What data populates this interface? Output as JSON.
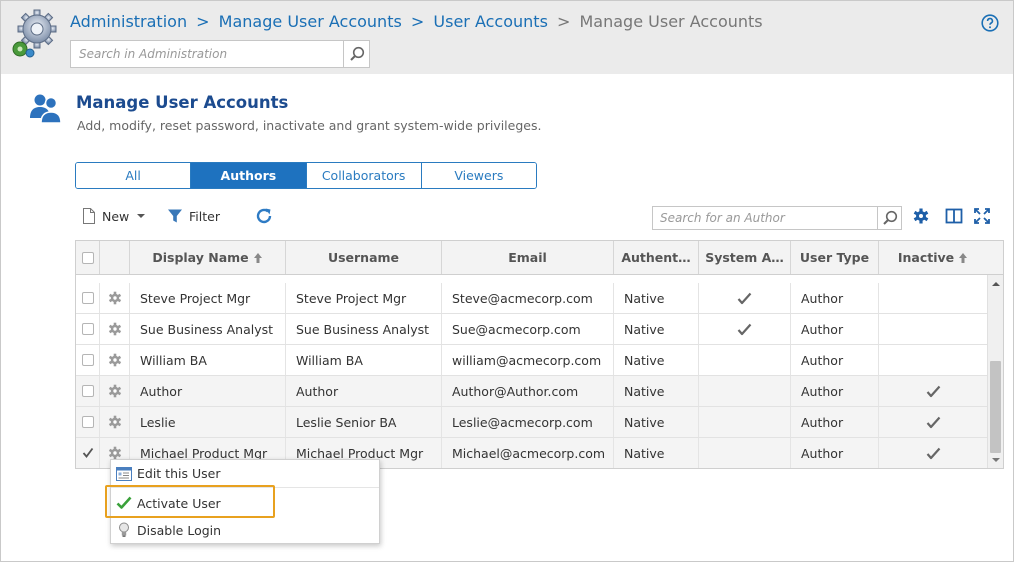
{
  "breadcrumb": {
    "items": [
      "Administration",
      "Manage User Accounts",
      "User Accounts"
    ],
    "current": "Manage User Accounts",
    "separator": ">"
  },
  "admin_search": {
    "placeholder": "Search in Administration"
  },
  "header": {
    "title": "Manage User Accounts",
    "description": "Add, modify, reset password, inactivate and grant system-wide privileges."
  },
  "tabs": [
    {
      "label": "All",
      "active": false
    },
    {
      "label": "Authors",
      "active": true
    },
    {
      "label": "Collaborators",
      "active": false
    },
    {
      "label": "Viewers",
      "active": false
    }
  ],
  "toolbar": {
    "new_label": "New",
    "filter_label": "Filter",
    "author_search_placeholder": "Search for an Author"
  },
  "grid": {
    "columns": [
      "Display Name",
      "Username",
      "Email",
      "Authent…",
      "System A…",
      "User Type",
      "Inactive"
    ],
    "sorted_columns": [
      "Display Name",
      "Inactive"
    ],
    "rows": [
      {
        "display_name": "Steve Project Mgr",
        "username": "Steve Project Mgr",
        "email": "Steve@acmecorp.com",
        "auth": "Native",
        "system_admin": true,
        "user_type": "Author",
        "inactive": false,
        "selected": false,
        "shaded": false
      },
      {
        "display_name": "Sue Business Analyst",
        "username": "Sue Business Analyst",
        "email": "Sue@acmecorp.com",
        "auth": "Native",
        "system_admin": true,
        "user_type": "Author",
        "inactive": false,
        "selected": false,
        "shaded": false
      },
      {
        "display_name": "William BA",
        "username": "William BA",
        "email": "william@acmecorp.com",
        "auth": "Native",
        "system_admin": false,
        "user_type": "Author",
        "inactive": false,
        "selected": false,
        "shaded": false
      },
      {
        "display_name": "Author",
        "username": "Author",
        "email": "Author@Author.com",
        "auth": "Native",
        "system_admin": false,
        "user_type": "Author",
        "inactive": true,
        "selected": false,
        "shaded": true
      },
      {
        "display_name": "Leslie",
        "username": "Leslie Senior BA",
        "email": "Leslie@acmecorp.com",
        "auth": "Native",
        "system_admin": false,
        "user_type": "Author",
        "inactive": true,
        "selected": false,
        "shaded": true
      },
      {
        "display_name": "Michael Product Mgr",
        "username": "Michael Product Mgr",
        "email": "Michael@acmecorp.com",
        "auth": "Native",
        "system_admin": false,
        "user_type": "Author",
        "inactive": true,
        "selected": true,
        "shaded": true
      }
    ]
  },
  "context_menu": {
    "items": [
      {
        "label": "Edit this User",
        "icon": "edit-user-icon"
      },
      {
        "label": "Activate User",
        "icon": "green-check-icon"
      },
      {
        "label": "Disable Login",
        "icon": "lightbulb-icon"
      }
    ]
  },
  "colors": {
    "link": "#1a6fb5",
    "title": "#1c4b8f",
    "active_tab": "#1e72bf",
    "highlight": "#e8a11f",
    "topbar": "#ebebeb"
  }
}
